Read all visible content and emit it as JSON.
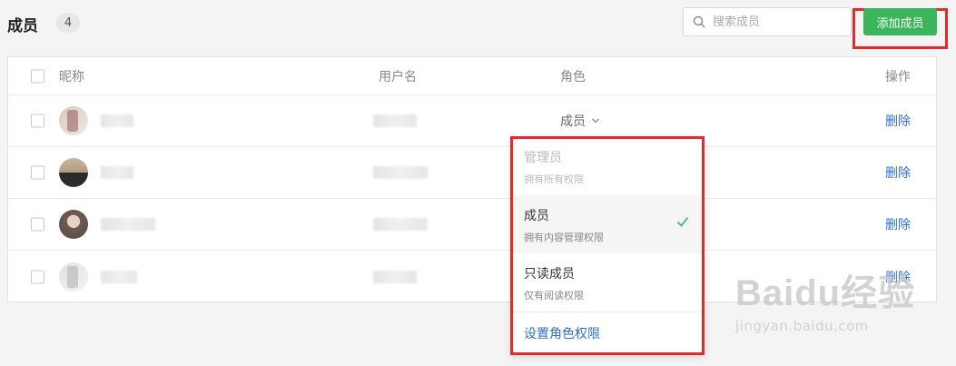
{
  "header": {
    "title": "成员",
    "count": "4",
    "search_placeholder": "搜索成员",
    "add_label": "添加成员"
  },
  "table": {
    "columns": {
      "nickname": "昵称",
      "username": "用户名",
      "role": "角色",
      "action": "操作"
    },
    "rows": [
      {
        "role": "成员",
        "delete_label": "删除"
      },
      {
        "delete_label": "删除"
      },
      {
        "delete_label": "删除"
      },
      {
        "delete_label": "删除"
      }
    ]
  },
  "role_dropdown": {
    "options": [
      {
        "title": "管理员",
        "desc": "拥有所有权限",
        "state": "disabled"
      },
      {
        "title": "成员",
        "desc": "拥有内容管理权限",
        "state": "selected"
      },
      {
        "title": "只读成员",
        "desc": "仅有阅读权限",
        "state": "normal"
      }
    ],
    "footer_link": "设置角色权限"
  },
  "watermark": {
    "logo_text": "Baidu经验",
    "url": "jingyan.baidu.com"
  },
  "colors": {
    "primary_green": "#3bb65c",
    "link_blue": "#2f6fd0",
    "highlight_red": "#e52a2a"
  }
}
